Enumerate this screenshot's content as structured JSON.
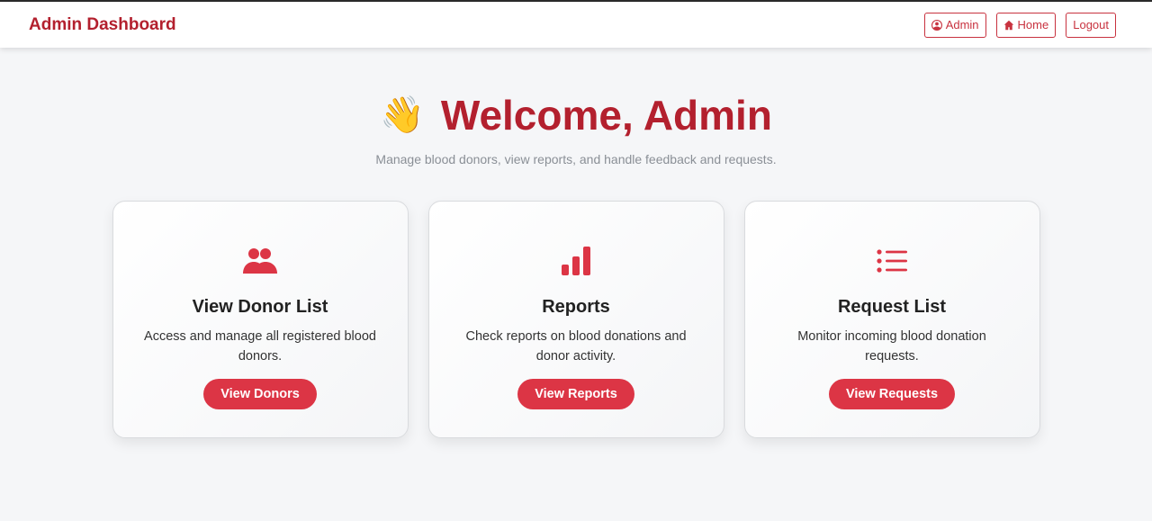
{
  "navbar": {
    "brand": "Admin Dashboard",
    "buttons": [
      {
        "label": "Admin",
        "icon": "user-circle-icon"
      },
      {
        "label": "Home",
        "icon": "home-icon"
      },
      {
        "label": "Logout"
      }
    ]
  },
  "hero": {
    "emoji": "👋",
    "title": "Welcome, Admin",
    "subtitle": "Manage blood donors, view reports, and handle feedback and requests."
  },
  "cards": [
    {
      "icon": "users-icon",
      "title": "View Donor List",
      "description": "Access and manage all registered blood donors.",
      "button": "View Donors"
    },
    {
      "icon": "bar-chart-icon",
      "title": "Reports",
      "description": "Check reports on blood donations and donor activity.",
      "button": "View Reports"
    },
    {
      "icon": "list-icon",
      "title": "Request List",
      "description": "Monitor incoming blood donation requests.",
      "button": "View Requests"
    }
  ],
  "colors": {
    "brand": "#b3202e",
    "accent": "#dc3545",
    "background": "#f5f6f8"
  }
}
